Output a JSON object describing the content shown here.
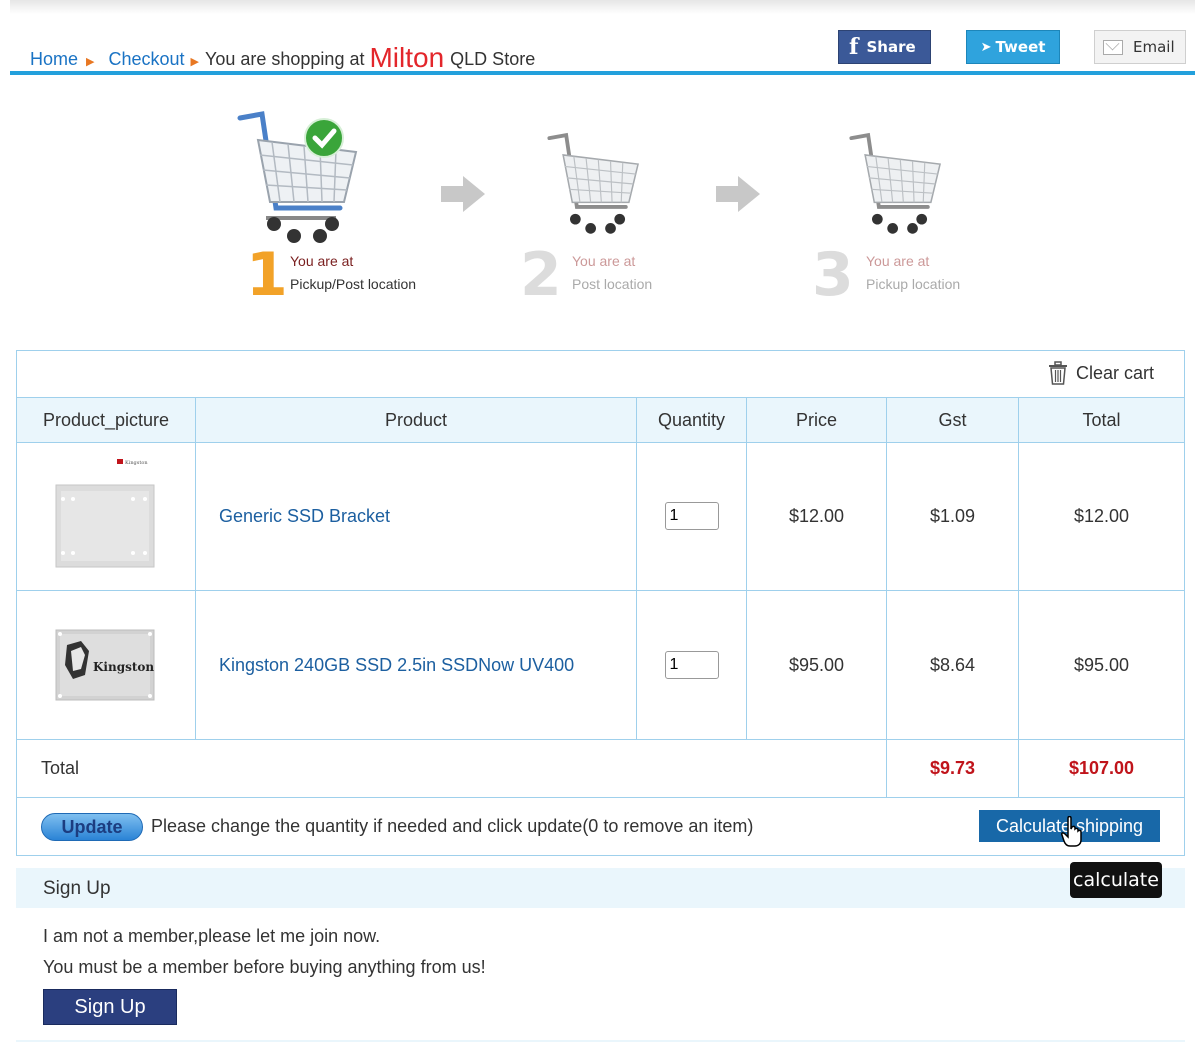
{
  "breadcrumb": {
    "home": "Home",
    "checkout": "Checkout",
    "prefix": "You are shopping at",
    "store": "Milton",
    "suffix": "QLD Store"
  },
  "social": {
    "share": "Share",
    "tweet": "Tweet",
    "email": "Email"
  },
  "steps": [
    {
      "number": "1",
      "line1": "You are at",
      "line2": "Pickup/Post location",
      "active": true
    },
    {
      "number": "2",
      "line1": "You are at",
      "line2": "Post location",
      "active": false
    },
    {
      "number": "3",
      "line1": "You are at",
      "line2": "Pickup location",
      "active": false
    }
  ],
  "cart": {
    "clear_label": "Clear cart",
    "columns": [
      "Product_picture",
      "Product",
      "Quantity",
      "Price",
      "Gst",
      "Total"
    ],
    "rows": [
      {
        "product": "Generic SSD Bracket",
        "quantity": "1",
        "price": "$12.00",
        "gst": "$1.09",
        "total": "$12.00",
        "thumb_brand": "Kingston"
      },
      {
        "product": "Kingston 240GB SSD 2.5in SSDNow UV400",
        "quantity": "1",
        "price": "$95.00",
        "gst": "$8.64",
        "total": "$95.00",
        "thumb_brand": "Kingston"
      }
    ],
    "total_label": "Total",
    "total_gst": "$9.73",
    "total_amount": "$107.00",
    "update_label": "Update",
    "hint": "Please change the quantity if needed and click update(0 to remove an item)",
    "calculate_label": "Calculate shipping",
    "tooltip": "calculate"
  },
  "signup": {
    "title": "Sign Up",
    "line1": "I am not a member,please let me join now.",
    "line2": "You must be a member before buying anything from us!",
    "button": "Sign Up"
  },
  "colors": {
    "accent": "#23a0dc",
    "link": "#1c5fa0",
    "price_red": "#c0141b",
    "store_red": "#e3262b"
  }
}
